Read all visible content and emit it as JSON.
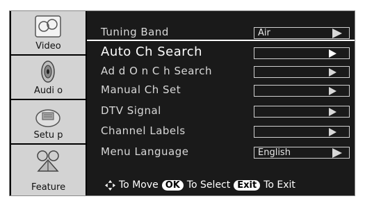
{
  "categories": [
    {
      "label": "Video",
      "icon": "video-icon"
    },
    {
      "label": "Audi o",
      "icon": "speaker-icon"
    },
    {
      "label": "Setu p",
      "icon": "setup-icon"
    },
    {
      "label": "Feature",
      "icon": "feature-icon"
    }
  ],
  "menu": {
    "items": [
      {
        "label": "Tuning  Band",
        "value": "Air"
      },
      {
        "label": "Auto  Ch  Search",
        "value": ""
      },
      {
        "label": "Ad d O n C h Search",
        "value": ""
      },
      {
        "label": "Manual  Ch  Set",
        "value": ""
      },
      {
        "label": "DTV  Signal",
        "value": ""
      },
      {
        "label": "Channel  Labels",
        "value": ""
      },
      {
        "label": "Menu  Language",
        "value": "English"
      }
    ]
  },
  "footer": {
    "move_text": "To Move",
    "ok_key": "OK",
    "select_text": "To Select",
    "exit_key": "Exit",
    "exit_text": "To Exit"
  }
}
